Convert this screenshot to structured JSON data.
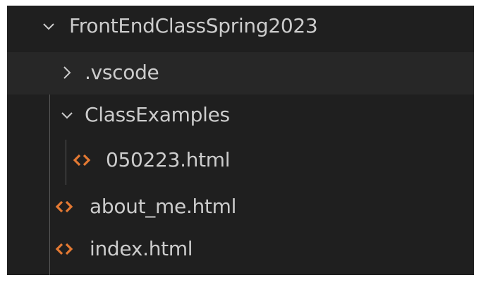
{
  "explorer": {
    "root_folder": {
      "label": "FrontEndClassSpring2023",
      "icon": "chevron-down-icon",
      "expanded": true
    },
    "items": [
      {
        "label": ".vscode",
        "type": "folder",
        "expanded": false,
        "icon": "chevron-right-icon"
      },
      {
        "label": "ClassExamples",
        "type": "folder",
        "expanded": true,
        "icon": "chevron-down-icon"
      },
      {
        "label": "050223.html",
        "type": "file",
        "icon": "html-file-icon"
      },
      {
        "label": "about_me.html",
        "type": "file",
        "icon": "html-file-icon"
      },
      {
        "label": "index.html",
        "type": "file",
        "icon": "html-file-icon"
      }
    ],
    "colors": {
      "background": "#1f1f1f",
      "hover_row": "#272727",
      "text": "#cccccc",
      "html_icon": "#e37933",
      "indent_guide": "#585858"
    }
  }
}
